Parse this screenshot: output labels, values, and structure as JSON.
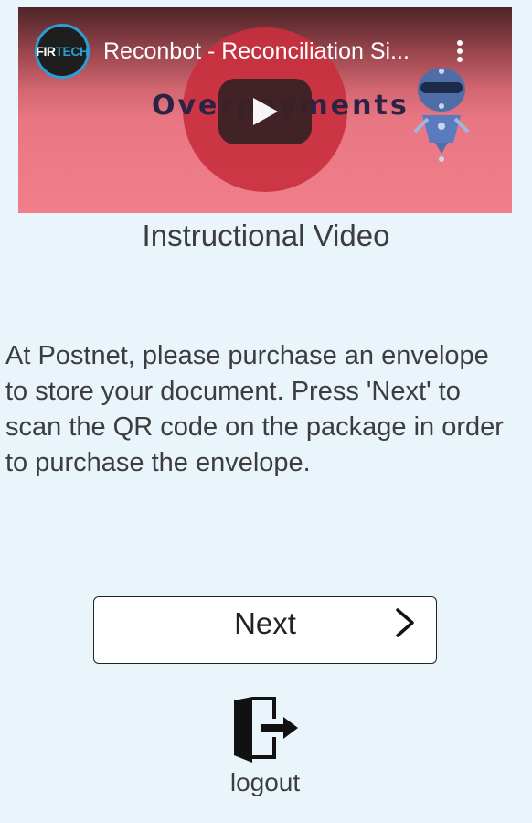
{
  "video": {
    "channel_logo_text_a": "FIR",
    "channel_logo_text_b": "TECH",
    "title": "Reconbot - Reconciliation Si...",
    "overlay_word": "Overpayments",
    "menu_icon": "kebab-menu-icon",
    "play_icon": "play-icon"
  },
  "caption": "Instructional Video",
  "instructions": "At Postnet, please purchase an envelope to store your document. Press 'Next' to scan the QR code on the package in order to purchase the envelope.",
  "next_button": {
    "label": "Next",
    "icon": "chevron-right-icon"
  },
  "logout": {
    "label": "logout",
    "icon": "logout-door-icon"
  },
  "colors": {
    "background": "#eaf4fb",
    "text": "#3d3d3d",
    "video_red": "#c9303f",
    "logo_accent": "#2a9fd6"
  }
}
